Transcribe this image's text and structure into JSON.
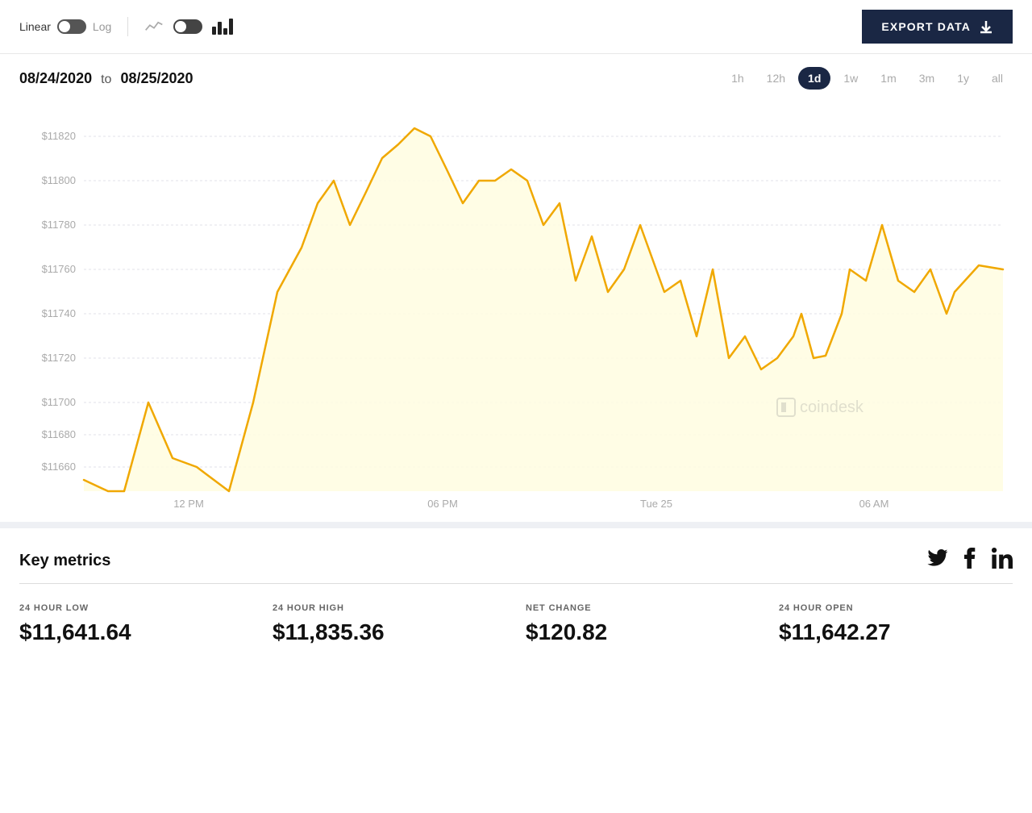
{
  "toolbar": {
    "linear_label": "Linear",
    "log_label": "Log",
    "export_label": "EXPORT DATA"
  },
  "chart_controls": {
    "date_from": "08/24/2020",
    "to_label": "to",
    "date_to": "08/25/2020",
    "time_options": [
      "1h",
      "12h",
      "1d",
      "1w",
      "1m",
      "3m",
      "1y",
      "all"
    ],
    "active_time": "1d"
  },
  "chart": {
    "y_labels": [
      "$11820",
      "$11800",
      "$11780",
      "$11760",
      "$11740",
      "$11720",
      "$11700",
      "$11680",
      "$11660"
    ],
    "x_labels": [
      "12 PM",
      "06 PM",
      "Tue 25",
      "06 AM"
    ],
    "watermark": "coindesk"
  },
  "key_metrics": {
    "title": "Key metrics",
    "metrics": [
      {
        "label": "24 HOUR LOW",
        "value": "$11,641.64"
      },
      {
        "label": "24 HOUR HIGH",
        "value": "$11,835.36"
      },
      {
        "label": "NET CHANGE",
        "value": "$120.82"
      },
      {
        "label": "24 HOUR OPEN",
        "value": "$11,642.27"
      }
    ]
  },
  "social": {
    "twitter": "🐦",
    "facebook": "f",
    "linkedin": "in"
  }
}
